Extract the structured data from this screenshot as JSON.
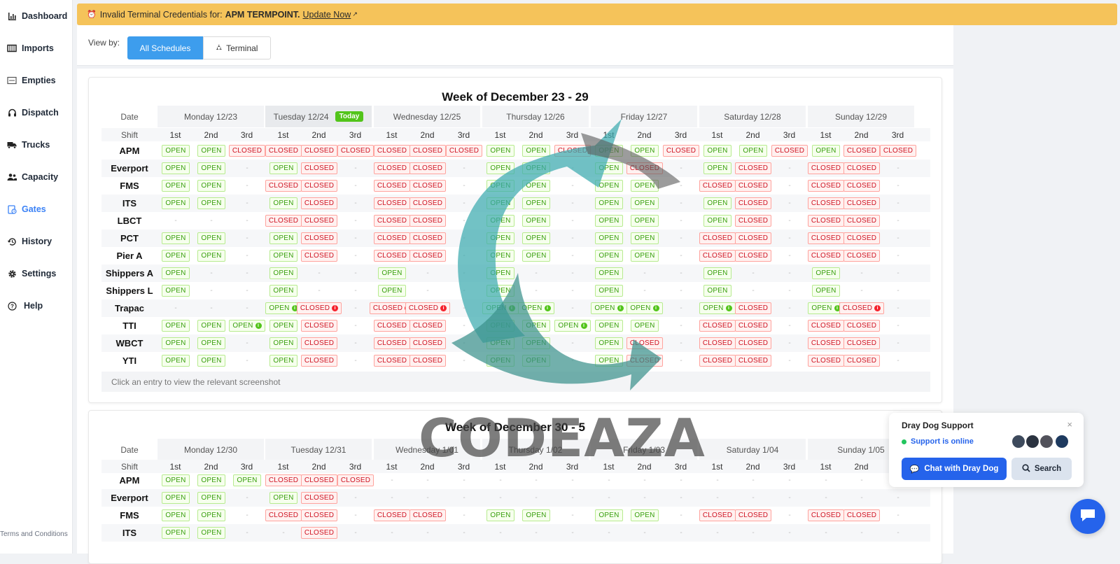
{
  "sidebar": {
    "items": [
      {
        "label": "Dashboard",
        "icon": "bar-chart-icon",
        "active": false
      },
      {
        "label": "Imports",
        "icon": "container-icon",
        "active": false
      },
      {
        "label": "Empties",
        "icon": "empty-container-icon",
        "active": false
      },
      {
        "label": "Dispatch",
        "icon": "headset-icon",
        "active": false
      },
      {
        "label": "Trucks",
        "icon": "truck-icon",
        "active": false
      },
      {
        "label": "Capacity",
        "icon": "users-icon",
        "active": false
      },
      {
        "label": "Gates",
        "icon": "gate-clock-icon",
        "active": true
      },
      {
        "label": "History",
        "icon": "history-icon",
        "active": false
      },
      {
        "label": "Settings",
        "icon": "gear-icon",
        "active": false
      },
      {
        "label": "Help",
        "icon": "help-circle-icon",
        "active": false
      }
    ],
    "terms": "Terms and Conditions"
  },
  "banner": {
    "prefix": "Invalid Terminal Credentials for:",
    "terminal": "APM TERMPOINT.",
    "link": "Update Now"
  },
  "view": {
    "label": "View by:",
    "all_schedules": "All Schedules",
    "terminal": "Terminal"
  },
  "table_labels": {
    "date": "Date",
    "shift": "Shift",
    "shifts": [
      "1st",
      "2nd",
      "3rd"
    ],
    "today": "Today"
  },
  "weeks": [
    {
      "title": "Week of December 23 - 29",
      "days": [
        "Monday 12/23",
        "Tuesday 12/24",
        "Wednesday 12/25",
        "Thursday 12/26",
        "Friday 12/27",
        "Saturday 12/28",
        "Sunday 12/29"
      ],
      "today_index": 1,
      "rows": [
        {
          "terminal": "APM",
          "cells": [
            "O",
            "O",
            "C",
            "C",
            "C",
            "C",
            "C",
            "C",
            "C",
            "O",
            "O",
            "C",
            "O",
            "O",
            "C",
            "O",
            "O",
            "C",
            "O",
            "C",
            "C"
          ]
        },
        {
          "terminal": "Everport",
          "cells": [
            "O",
            "O",
            "-",
            "O",
            "C",
            "-",
            "C",
            "C",
            "-",
            "O",
            "O",
            "-",
            "O",
            "C",
            "-",
            "O",
            "C",
            "-",
            "C",
            "C",
            "-"
          ]
        },
        {
          "terminal": "FMS",
          "cells": [
            "O",
            "O",
            "-",
            "C",
            "C",
            "-",
            "C",
            "C",
            "-",
            "O",
            "O",
            "-",
            "O",
            "O",
            "-",
            "C",
            "C",
            "-",
            "C",
            "C",
            "-"
          ]
        },
        {
          "terminal": "ITS",
          "cells": [
            "O",
            "O",
            "-",
            "O",
            "C",
            "-",
            "C",
            "C",
            "-",
            "O",
            "O",
            "-",
            "O",
            "O",
            "-",
            "O",
            "C",
            "-",
            "C",
            "C",
            "-"
          ]
        },
        {
          "terminal": "LBCT",
          "cells": [
            "-",
            "-",
            "-",
            "C",
            "C",
            "-",
            "C",
            "C",
            "-",
            "O",
            "O",
            "-",
            "O",
            "O",
            "-",
            "O",
            "C",
            "-",
            "C",
            "C",
            "-"
          ]
        },
        {
          "terminal": "PCT",
          "cells": [
            "O",
            "O",
            "-",
            "O",
            "C",
            "-",
            "C",
            "C",
            "-",
            "O",
            "O",
            "-",
            "O",
            "O",
            "-",
            "C",
            "C",
            "-",
            "C",
            "C",
            "-"
          ]
        },
        {
          "terminal": "Pier A",
          "cells": [
            "O",
            "O",
            "-",
            "O",
            "C",
            "-",
            "C",
            "C",
            "-",
            "O",
            "O",
            "-",
            "O",
            "O",
            "-",
            "C",
            "C",
            "-",
            "C",
            "C",
            "-"
          ]
        },
        {
          "terminal": "Shippers A",
          "cells": [
            "O",
            "-",
            "-",
            "O",
            "-",
            "-",
            "O",
            "-",
            "-",
            "O",
            "-",
            "-",
            "O",
            "-",
            "-",
            "O",
            "-",
            "-",
            "O",
            "-",
            "-"
          ]
        },
        {
          "terminal": "Shippers L",
          "cells": [
            "O",
            "-",
            "-",
            "O",
            "-",
            "-",
            "O",
            "-",
            "-",
            "O",
            "-",
            "-",
            "O",
            "-",
            "-",
            "O",
            "-",
            "-",
            "O",
            "-",
            "-"
          ]
        },
        {
          "terminal": "Trapac",
          "cells": [
            "-",
            "-",
            "-",
            "Oi",
            "Ci",
            "-",
            "Ci",
            "Ci",
            "-",
            "Oi",
            "Oi",
            "-",
            "Oi",
            "Oi",
            "-",
            "Oi",
            "C",
            "-",
            "Oi",
            "Ci",
            "-"
          ]
        },
        {
          "terminal": "TTI",
          "cells": [
            "O",
            "O",
            "Oi",
            "O",
            "C",
            "-",
            "C",
            "C",
            "-",
            "O",
            "O",
            "Oi",
            "O",
            "O",
            "-",
            "C",
            "C",
            "-",
            "C",
            "C",
            "-"
          ]
        },
        {
          "terminal": "WBCT",
          "cells": [
            "O",
            "O",
            "-",
            "O",
            "C",
            "-",
            "C",
            "C",
            "-",
            "O",
            "O",
            "-",
            "O",
            "C",
            "-",
            "C",
            "C",
            "-",
            "C",
            "C",
            "-"
          ]
        },
        {
          "terminal": "YTI",
          "cells": [
            "O",
            "O",
            "-",
            "O",
            "C",
            "-",
            "C",
            "C",
            "-",
            "O",
            "O",
            "-",
            "O",
            "C",
            "-",
            "C",
            "C",
            "-",
            "C",
            "C",
            "-"
          ]
        }
      ],
      "note": "Click an entry to view the relevant screenshot"
    },
    {
      "title": "Week of December 30 - 5",
      "days": [
        "Monday 12/30",
        "Tuesday 12/31",
        "Wednesday 1/01",
        "Thursday 1/02",
        "Friday 1/03",
        "Saturday 1/04",
        "Sunday 1/05"
      ],
      "today_index": -1,
      "rows": [
        {
          "terminal": "APM",
          "cells": [
            "O",
            "O",
            "O",
            "C",
            "C",
            "C",
            "-",
            "-",
            "-",
            "-",
            "-",
            "-",
            "-",
            "-",
            "-",
            "-",
            "-",
            "-",
            "-",
            "-",
            "-"
          ]
        },
        {
          "terminal": "Everport",
          "cells": [
            "O",
            "O",
            "-",
            "O",
            "C",
            "-",
            "-",
            "-",
            "-",
            "-",
            "-",
            "-",
            "-",
            "-",
            "-",
            "-",
            "-",
            "-",
            "-",
            "-",
            "-"
          ]
        },
        {
          "terminal": "FMS",
          "cells": [
            "O",
            "O",
            "-",
            "C",
            "C",
            "-",
            "C",
            "C",
            "-",
            "O",
            "O",
            "-",
            "O",
            "O",
            "-",
            "C",
            "C",
            "-",
            "C",
            "C",
            "-"
          ]
        },
        {
          "terminal": "ITS",
          "cells": [
            "O",
            "O",
            "-",
            "-",
            "C",
            "-",
            "-",
            "-",
            "-",
            "-",
            "-",
            "-",
            "-",
            "-",
            "-",
            "-",
            "-",
            "-",
            "-",
            "-",
            "-"
          ]
        }
      ]
    }
  ],
  "status": {
    "open": "OPEN",
    "closed": "CLOSED",
    "none": "-",
    "info": "i"
  },
  "watermark": "CODEAZA",
  "support": {
    "title": "Dray Dog Support",
    "close": "×",
    "online": "Support is online",
    "chat": "Chat with Dray Dog",
    "search": "Search"
  },
  "colors": {
    "accent": "#3d9ded",
    "banner": "#f5c35a",
    "open": "#389e0d",
    "closed": "#cf1322",
    "support_blue": "#2563eb"
  }
}
